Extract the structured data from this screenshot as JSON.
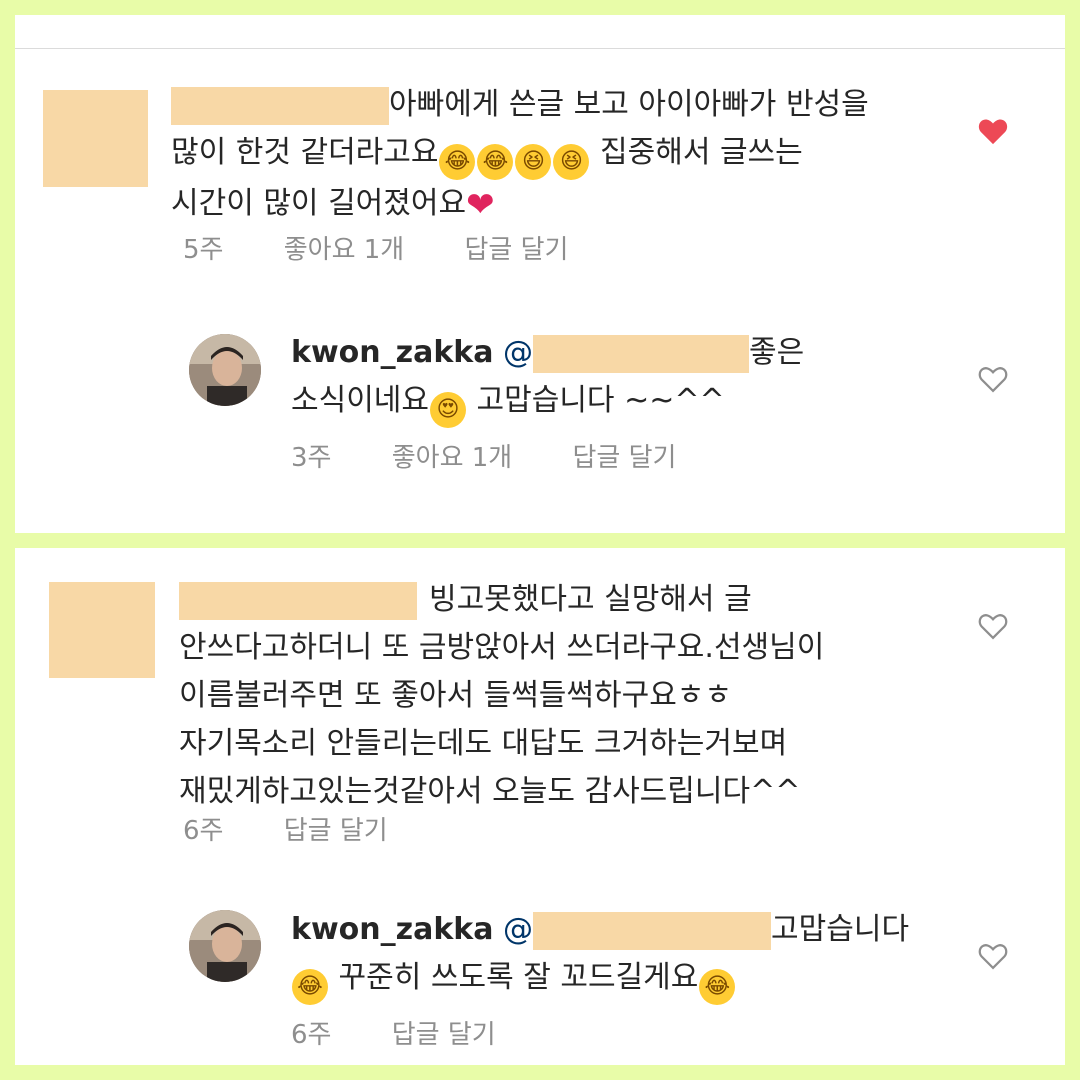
{
  "comment1": {
    "text_line1": "아빠에게 쓴글 보고 아이아빠가 반성을",
    "text_line2_before": "많이 한것 같더라고요",
    "text_line2_emojis": [
      "😂",
      "😂",
      "😆",
      "😆"
    ],
    "text_line2_after": " 집중해서 글쓰는",
    "text_line3": "시간이 많이 길어졌어요",
    "text_line3_emoji": "❤️",
    "time": "5주",
    "likes": "좋아요 1개",
    "reply": "답글 달기",
    "liked": true
  },
  "reply1": {
    "username": "kwon_zakka",
    "mention_at": "@",
    "text_line1": "좋은",
    "text_line2_before": "소식이네요",
    "text_line2_emoji": "😍",
    "text_line2_after": "  고맙습니다 ~~^^",
    "time": "3주",
    "likes": "좋아요 1개",
    "reply": "답글 달기"
  },
  "comment2": {
    "text_line1": "빙고못했다고 실망해서 글",
    "text_line2": "안쓰다고하더니 또 금방앉아서 쓰더라구요.선생님이",
    "text_line3": "이름불러주면 또  좋아서 들썩들썩하구요ㅎㅎ",
    "text_line4": "자기목소리 안들리는데도 대답도 크거하는거보며",
    "text_line5": "재밌게하고있는것같아서 오늘도 감사드립니다^^",
    "time": "6주",
    "reply": "답글 달기"
  },
  "reply2": {
    "username": "kwon_zakka",
    "mention_at": "@",
    "text_line1": "고맙습니다",
    "text_line2_emoji_start": "😂",
    "text_line2": "  꾸준히 쓰도록 잘 꼬드길게요",
    "text_line2_emoji_end": "😂",
    "time": "6주",
    "reply": "답글 달기"
  },
  "colors": {
    "background": "#e8fca8",
    "redaction": "#f8d8a6",
    "heart_active": "#ed4956",
    "meta_gray": "#8e8e8e",
    "mention_blue": "#003569"
  }
}
